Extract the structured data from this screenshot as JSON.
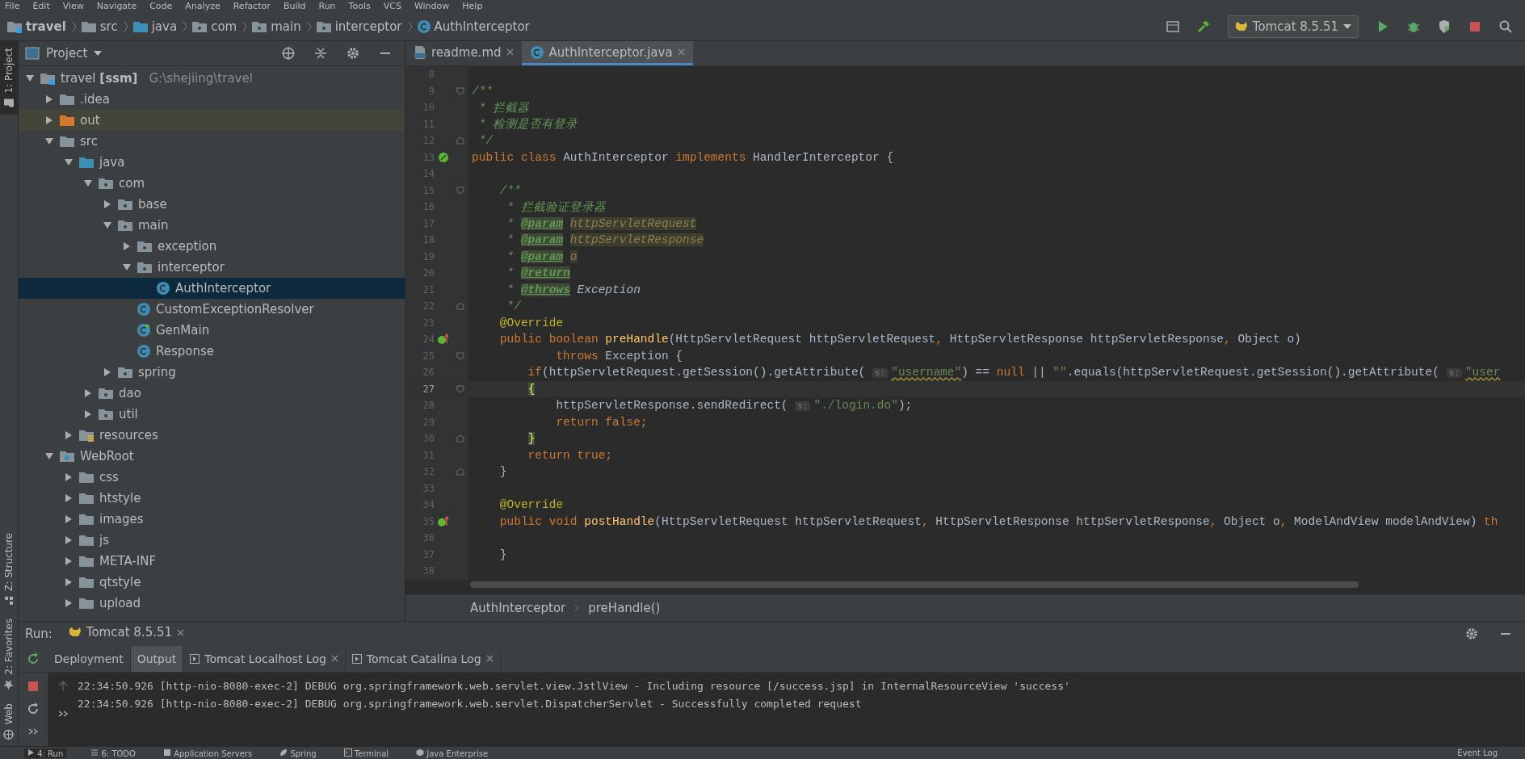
{
  "menu": [
    "File",
    "Edit",
    "View",
    "Navigate",
    "Code",
    "Analyze",
    "Refactor",
    "Build",
    "Run",
    "Tools",
    "VCS",
    "Window",
    "Help"
  ],
  "nav_path": [
    {
      "label": "travel",
      "kind": "module"
    },
    {
      "label": "src",
      "kind": "folder"
    },
    {
      "label": "java",
      "kind": "source"
    },
    {
      "label": "com",
      "kind": "package"
    },
    {
      "label": "main",
      "kind": "package"
    },
    {
      "label": "interceptor",
      "kind": "package"
    },
    {
      "label": "AuthInterceptor",
      "kind": "class"
    }
  ],
  "run_config": "Tomcat 8.5.51",
  "side_stripe": [
    {
      "label": "1: Project",
      "kind": "project",
      "selected": true
    },
    {
      "label": "Z: Structure",
      "kind": "structure",
      "selected": false
    },
    {
      "label": "2: Favorites",
      "kind": "favorites",
      "selected": false
    },
    {
      "label": "Web",
      "kind": "web",
      "selected": false
    }
  ],
  "project_panel": {
    "title": "Project",
    "tree": [
      {
        "label": "travel **[ssm]**",
        "path": "G:\\shejiing\\travel",
        "kind": "module",
        "expanded": true,
        "selected": false,
        "children": [
          {
            "label": ".idea",
            "kind": "folder",
            "expanded": false,
            "selected": false
          },
          {
            "label": "out",
            "kind": "excluded",
            "expanded": false,
            "selected": false
          },
          {
            "label": "src",
            "kind": "folder",
            "expanded": true,
            "selected": false,
            "children": [
              {
                "label": "java",
                "kind": "source",
                "expanded": true,
                "selected": false,
                "children": [
                  {
                    "label": "com",
                    "kind": "package",
                    "expanded": true,
                    "selected": false,
                    "children": [
                      {
                        "label": "base",
                        "kind": "package",
                        "expanded": false,
                        "selected": false
                      },
                      {
                        "label": "main",
                        "kind": "package",
                        "expanded": true,
                        "selected": false,
                        "children": [
                          {
                            "label": "exception",
                            "kind": "package",
                            "expanded": false,
                            "selected": false
                          },
                          {
                            "label": "interceptor",
                            "kind": "package",
                            "expanded": true,
                            "selected": false,
                            "children": [
                              {
                                "label": "AuthInterceptor",
                                "kind": "class",
                                "selected": true
                              }
                            ]
                          },
                          {
                            "label": "CustomExceptionResolver",
                            "kind": "class",
                            "selected": false
                          },
                          {
                            "label": "GenMain",
                            "kind": "main-class",
                            "selected": false
                          },
                          {
                            "label": "Response",
                            "kind": "class",
                            "selected": false
                          }
                        ]
                      },
                      {
                        "label": "spring",
                        "kind": "package",
                        "expanded": false,
                        "selected": false
                      }
                    ]
                  },
                  {
                    "label": "dao",
                    "kind": "package",
                    "expanded": false,
                    "selected": false
                  },
                  {
                    "label": "util",
                    "kind": "package",
                    "expanded": false,
                    "selected": false
                  }
                ]
              },
              {
                "label": "resources",
                "kind": "resources",
                "expanded": false,
                "selected": false
              }
            ]
          },
          {
            "label": "WebRoot",
            "kind": "web",
            "expanded": true,
            "selected": false,
            "children": [
              {
                "label": "css",
                "kind": "folder",
                "expanded": false,
                "selected": false
              },
              {
                "label": "htstyle",
                "kind": "folder",
                "expanded": false,
                "selected": false
              },
              {
                "label": "images",
                "kind": "folder",
                "expanded": false,
                "selected": false
              },
              {
                "label": "js",
                "kind": "folder",
                "expanded": false,
                "selected": false
              },
              {
                "label": "META-INF",
                "kind": "folder",
                "expanded": false,
                "selected": false
              },
              {
                "label": "qtstyle",
                "kind": "folder",
                "expanded": false,
                "selected": false
              },
              {
                "label": "upload",
                "kind": "folder",
                "expanded": false,
                "selected": false
              }
            ]
          }
        ]
      }
    ]
  },
  "editor": {
    "tabs": [
      {
        "label": "readme.md",
        "kind": "markdown",
        "selected": false
      },
      {
        "label": "AuthInterceptor.java",
        "kind": "class",
        "selected": true
      }
    ],
    "lines": [
      {
        "n": "8"
      },
      {
        "n": "9",
        "fold_start": true,
        "segs": [
          {
            "kind": "doc",
            "text": "/**"
          }
        ]
      },
      {
        "n": "10",
        "segs": [
          {
            "kind": "doc",
            "text": " * 拦截器"
          }
        ]
      },
      {
        "n": "11",
        "segs": [
          {
            "kind": "doc",
            "text": " * 检测是否有登录"
          }
        ]
      },
      {
        "n": "12",
        "fold_end": true,
        "segs": [
          {
            "kind": "doc",
            "text": " */"
          }
        ]
      },
      {
        "n": "13",
        "implements": true,
        "segs": [
          {
            "kind": "kw",
            "text": "public class "
          },
          {
            "kind": "plain",
            "text": "AuthInterceptor "
          },
          {
            "kind": "kw",
            "text": "implements "
          },
          {
            "kind": "plain",
            "text": "HandlerInterceptor {"
          }
        ]
      },
      {
        "n": "14"
      },
      {
        "n": "15",
        "fold_start": true,
        "segs": [
          {
            "kind": "doc",
            "text": "    /**"
          }
        ]
      },
      {
        "n": "16",
        "segs": [
          {
            "kind": "doc",
            "text": "     * 拦截验证登录器"
          }
        ]
      },
      {
        "n": "17",
        "segs": [
          {
            "kind": "doc",
            "text": "     * "
          },
          {
            "kind": "doc-tag",
            "text": "@param"
          },
          {
            "kind": "doc-ref",
            "text": "httpServletRequest"
          }
        ]
      },
      {
        "n": "18",
        "segs": [
          {
            "kind": "doc",
            "text": "     * "
          },
          {
            "kind": "doc-tag",
            "text": "@param"
          },
          {
            "kind": "doc-ref",
            "text": "httpServletResponse"
          }
        ]
      },
      {
        "n": "19",
        "segs": [
          {
            "kind": "doc",
            "text": "     * "
          },
          {
            "kind": "doc-tag",
            "text": "@param"
          },
          {
            "kind": "doc-ref",
            "text": "o"
          }
        ]
      },
      {
        "n": "20",
        "segs": [
          {
            "kind": "doc",
            "text": "     * "
          },
          {
            "kind": "doc-tag",
            "text": "@return"
          }
        ]
      },
      {
        "n": "21",
        "segs": [
          {
            "kind": "doc",
            "text": "     * "
          },
          {
            "kind": "doc-tag",
            "text": "@throws"
          },
          {
            "kind": "doc-type",
            "text": "Exception"
          }
        ]
      },
      {
        "n": "22",
        "fold_end": true,
        "segs": [
          {
            "kind": "doc",
            "text": "     */"
          }
        ]
      },
      {
        "n": "23",
        "segs": [
          {
            "kind": "annotation",
            "text": "    @Override"
          }
        ]
      },
      {
        "n": "24",
        "overrides": true,
        "segs": [
          {
            "kind": "kw",
            "text": "    public boolean "
          },
          {
            "kind": "method",
            "text": "preHandle"
          },
          {
            "kind": "plain",
            "text": "(HttpServletRequest httpServletRequest"
          },
          {
            "kind": "kw",
            "text": ", "
          },
          {
            "kind": "plain",
            "text": "HttpServletResponse httpServletResponse"
          },
          {
            "kind": "kw",
            "text": ", "
          },
          {
            "kind": "plain",
            "text": "Object o)"
          }
        ]
      },
      {
        "n": "25",
        "fold_start": true,
        "segs": [
          {
            "kind": "kw",
            "text": "            throws "
          },
          {
            "kind": "plain",
            "text": "Exception {"
          }
        ]
      },
      {
        "n": "26",
        "segs": [
          {
            "kind": "kw",
            "text": "        if"
          },
          {
            "kind": "plain",
            "text": "(httpServletRequest.getSession().getAttribute( "
          },
          {
            "kind": "hint",
            "text": "s:"
          },
          {
            "kind": "string-warn",
            "text": "\"username\""
          },
          {
            "kind": "plain",
            "text": ") == "
          },
          {
            "kind": "kw",
            "text": "null"
          },
          {
            "kind": "plain",
            "text": " || "
          },
          {
            "kind": "string",
            "text": "\"\""
          },
          {
            "kind": "plain",
            "text": ".equals(httpServletRequest.getSession().getAttribute( "
          },
          {
            "kind": "hint",
            "text": "s:"
          },
          {
            "kind": "string-warn",
            "text": "\"user"
          }
        ]
      },
      {
        "n": "27",
        "fold_start": true,
        "current": true,
        "segs": [
          {
            "kind": "brace-match",
            "text": "        {"
          }
        ]
      },
      {
        "n": "28",
        "segs": [
          {
            "kind": "plain",
            "text": "            httpServletResponse.sendRedirect( "
          },
          {
            "kind": "hint",
            "text": "s:"
          },
          {
            "kind": "string",
            "text": "\"./login.do\""
          },
          {
            "kind": "plain",
            "text": ");"
          }
        ]
      },
      {
        "n": "29",
        "segs": [
          {
            "kind": "kw",
            "text": "            return false;"
          }
        ]
      },
      {
        "n": "30",
        "fold_end": true,
        "segs": [
          {
            "kind": "brace-match",
            "text": "        }"
          }
        ]
      },
      {
        "n": "31",
        "segs": [
          {
            "kind": "kw",
            "text": "        return true;"
          }
        ]
      },
      {
        "n": "32",
        "fold_end": true,
        "segs": [
          {
            "kind": "plain",
            "text": "    }"
          }
        ]
      },
      {
        "n": "33"
      },
      {
        "n": "34",
        "segs": [
          {
            "kind": "annotation",
            "text": "    @Override"
          }
        ]
      },
      {
        "n": "35",
        "overrides": true,
        "segs": [
          {
            "kind": "kw",
            "text": "    public void "
          },
          {
            "kind": "method",
            "text": "postHandle"
          },
          {
            "kind": "plain",
            "text": "(HttpServletRequest httpServletRequest"
          },
          {
            "kind": "kw",
            "text": ", "
          },
          {
            "kind": "plain",
            "text": "HttpServletResponse httpServletResponse"
          },
          {
            "kind": "kw",
            "text": ", "
          },
          {
            "kind": "plain",
            "text": "Object o"
          },
          {
            "kind": "kw",
            "text": ", "
          },
          {
            "kind": "plain",
            "text": "ModelAndView modelAndView) "
          },
          {
            "kind": "kw",
            "text": "th"
          }
        ]
      },
      {
        "n": "36"
      },
      {
        "n": "37",
        "segs": [
          {
            "kind": "plain",
            "text": "    }"
          }
        ]
      },
      {
        "n": "38"
      }
    ],
    "breadcrumb": [
      "AuthInterceptor",
      "preHandle()"
    ]
  },
  "run_panel": {
    "label": "Run:",
    "config_tab": "Tomcat 8.5.51",
    "tabs": [
      {
        "label": "Deployment",
        "kind": "plain",
        "selected": false
      },
      {
        "label": "Output",
        "kind": "plain",
        "selected": true
      },
      {
        "label": "Tomcat Localhost Log",
        "kind": "log",
        "selected": false
      },
      {
        "label": "Tomcat Catalina Log",
        "kind": "log",
        "selected": false
      }
    ],
    "log": [
      "22:34:50.926 [http-nio-8080-exec-2] DEBUG org.springframework.web.servlet.view.JstlView - Including resource [/success.jsp] in InternalResourceView 'success'",
      "22:34:50.926 [http-nio-8080-exec-2] DEBUG org.springframework.web.servlet.DispatcherServlet - Successfully completed request"
    ]
  },
  "bottom_tabs": [
    {
      "label": "4: Run",
      "kind": "run",
      "selected": true
    },
    {
      "label": "6: TODO",
      "kind": "todo",
      "selected": false
    },
    {
      "label": "Application Servers",
      "kind": "servers",
      "selected": false
    },
    {
      "label": "Spring",
      "kind": "spring",
      "selected": false
    },
    {
      "label": "Terminal",
      "kind": "terminal",
      "selected": false
    },
    {
      "label": "Java Enterprise",
      "kind": "enterprise",
      "selected": false
    }
  ],
  "event_log": "Event Log"
}
